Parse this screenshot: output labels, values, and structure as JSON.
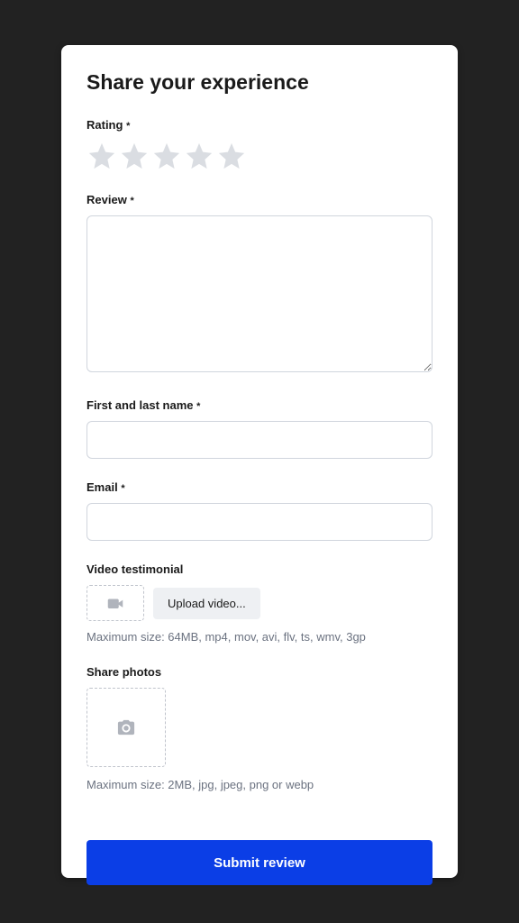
{
  "title": "Share your experience",
  "rating": {
    "label": "Rating",
    "required": "*",
    "value": 0,
    "max": 5
  },
  "review": {
    "label": "Review",
    "required": "*",
    "value": ""
  },
  "name": {
    "label": "First and last name",
    "required": "*",
    "value": ""
  },
  "email": {
    "label": "Email",
    "required": "*",
    "value": ""
  },
  "video": {
    "label": "Video testimonial",
    "button": "Upload video...",
    "helper": "Maximum size: 64MB, mp4, mov, avi, flv, ts, wmv, 3gp"
  },
  "photos": {
    "label": "Share photos",
    "helper": "Maximum size: 2MB, jpg, jpeg, png or webp"
  },
  "submit": {
    "label": "Submit review"
  }
}
